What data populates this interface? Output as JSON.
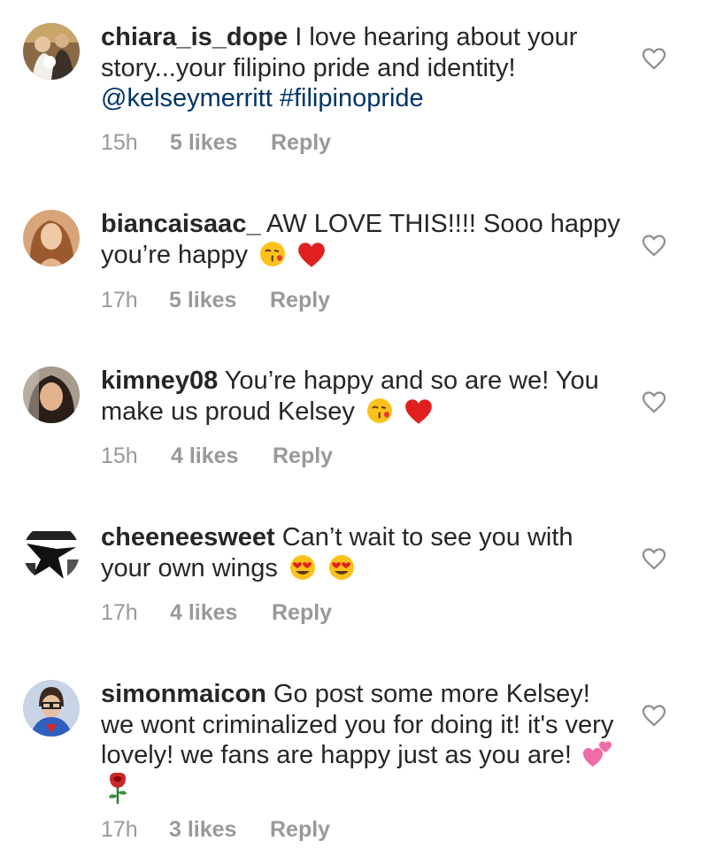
{
  "comments": [
    {
      "username": "chiara_is_dope",
      "text": "I love hearing about your story...your filipino pride and identity!",
      "tags": "@kelseymerritt #filipinopride",
      "time": "15h",
      "likes": "5 likes",
      "reply": "Reply",
      "emojis": []
    },
    {
      "username": "biancaisaac_",
      "text": "AW LOVE THIS!!!! Sooo happy you’re happy",
      "time": "17h",
      "likes": "5 likes",
      "reply": "Reply",
      "emojis": [
        "kissing-face-emoji",
        "red-heart-emoji"
      ]
    },
    {
      "username": "kimney08",
      "text": "You’re happy and so are we! You make us proud Kelsey",
      "time": "15h",
      "likes": "4 likes",
      "reply": "Reply",
      "emojis": [
        "kissing-face-emoji",
        "red-heart-emoji"
      ]
    },
    {
      "username": "cheeneesweet",
      "text": "Can’t wait to see you with your own wings",
      "time": "17h",
      "likes": "4 likes",
      "reply": "Reply",
      "emojis": [
        "heart-eyes-emoji",
        "heart-eyes-emoji"
      ]
    },
    {
      "username": "simonmaicon",
      "text": "Go post some more Kelsey! we wont criminalized you for doing it! it's very lovely! we fans are happy just as you are!",
      "time": "17h",
      "likes": "3 likes",
      "reply": "Reply",
      "emojis": [
        "two-hearts-emoji",
        "rose-emoji"
      ]
    }
  ],
  "colors": {
    "text": "#262626",
    "hashtag": "#003569",
    "meta": "#999999"
  }
}
